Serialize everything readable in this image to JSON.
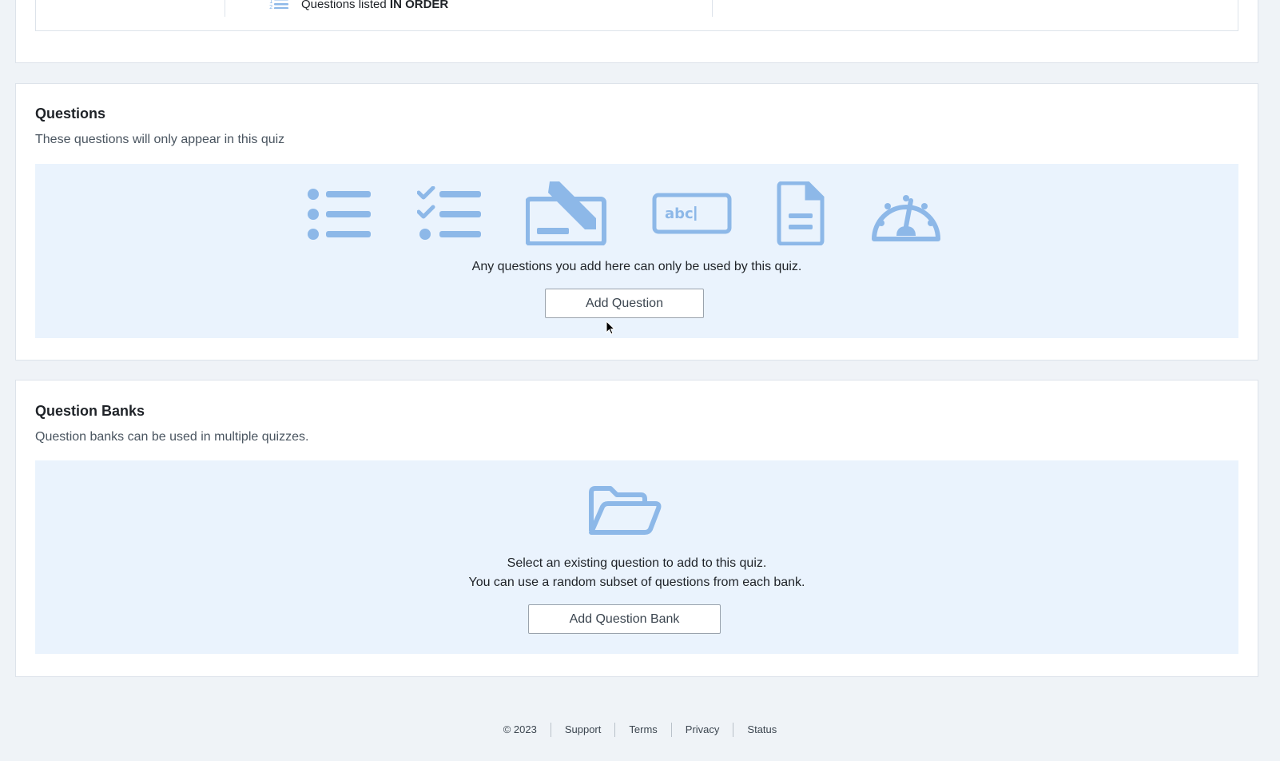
{
  "top_section": {
    "order_prefix": "Questions listed",
    "order_value": "IN ORDER"
  },
  "questions": {
    "title": "Questions",
    "subtitle": "These questions will only appear in this quiz",
    "icons": [
      "bullet-list-icon",
      "checklist-icon",
      "essay-icon",
      "text-input-icon",
      "document-icon",
      "gauge-icon"
    ],
    "empty_message": "Any questions you add here can only be used by this quiz.",
    "add_button": "Add Question"
  },
  "question_banks": {
    "title": "Question Banks",
    "subtitle": "Question banks can be used in multiple quizzes.",
    "icon": "folder-open-icon",
    "message_line1": "Select an existing question to add to this quiz.",
    "message_line2": "You can use a random subset of questions from each bank.",
    "add_button": "Add Question Bank"
  },
  "footer": {
    "copyright": "© 2023",
    "links": [
      "Support",
      "Terms",
      "Privacy",
      "Status"
    ]
  },
  "colors": {
    "icon": "#8db8e8",
    "panel_bg": "#eaf3fd",
    "page_bg": "#eff3f7"
  }
}
